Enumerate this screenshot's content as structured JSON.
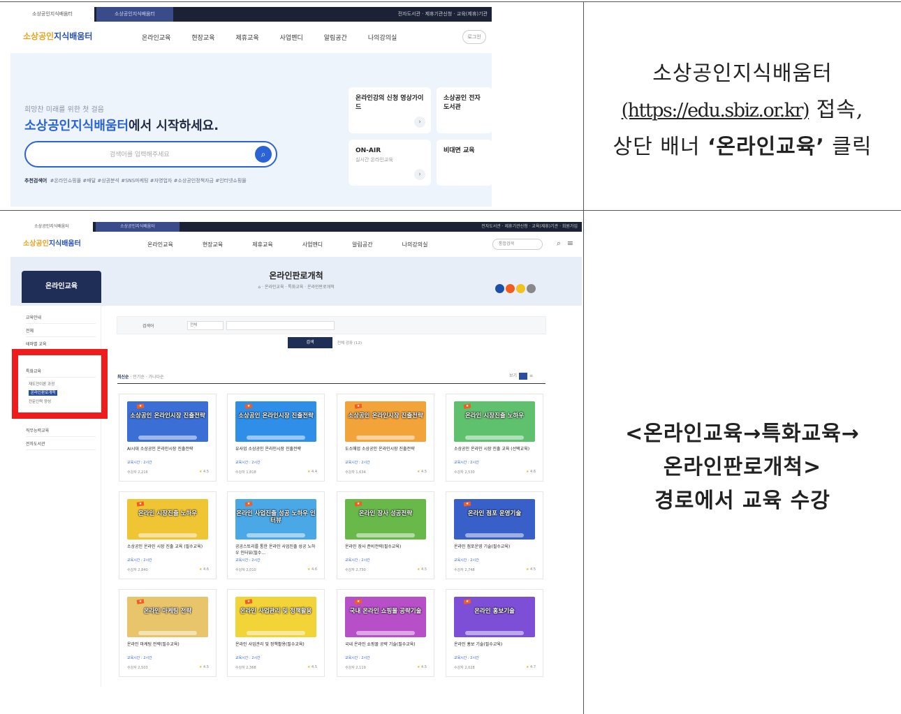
{
  "right_column": {
    "row1": {
      "line1": "소상공인지식배움터",
      "url": "(https://edu.sbiz.or.kr)",
      "line2_suffix": " 접속,",
      "line3_prefix": "상단 배너 ",
      "line3_bold": "‘온라인교육’",
      "line3_suffix": " 클릭"
    },
    "row2": {
      "line1": "<온라인교육→특화교육→",
      "line2": "온라인판로개척>",
      "line3": "경로에서 교육 수강"
    }
  },
  "screenshot1": {
    "top_tab_1": "소상공인지식배움터",
    "top_tab_2": "소상공인지식배움터",
    "top_right": "전자도서관 · 제휴기관신청 · 교육(제휴)기관",
    "logo_a": "소상공인",
    "logo_b": "지식배움터",
    "menu": [
      "온라인교육",
      "현장교육",
      "제휴교육",
      "사업멘디",
      "알림공간",
      "나의강의실"
    ],
    "login": "로그인",
    "hero_sub": "희망찬 미래를 위한 첫 걸음",
    "hero_title_highlight": "소상공인지식배움터",
    "hero_title_rest": "에서 시작하세요.",
    "search_placeholder": "검색어를 입력해주세요",
    "tags_label": "추천검색어",
    "tags": "#온라인쇼핑몰  #배달  #상권분석  #SNS마케팅  #자영업자  #소상공인정책자금  #인터넷쇼핑몰",
    "cards": [
      {
        "title": "온라인강의 신청 영상가이드",
        "sub": ""
      },
      {
        "title": "소상공인 전자도서관",
        "sub": ""
      },
      {
        "title": "ON-AIR",
        "sub": "실시간 온라인교육"
      },
      {
        "title": "비대면 교육",
        "sub": ""
      }
    ]
  },
  "screenshot2": {
    "top_tab_1": "소상공인지식배움터",
    "top_tab_2": "소상공인지식배움터",
    "top_right": "전자도서관 · 제휴기관신청 · 교육(제휴)기관 · 회원가입",
    "logo_a": "소상공인",
    "logo_b": "지식배움터",
    "menu": [
      "온라인교육",
      "현장교육",
      "제휴교육",
      "사업멘디",
      "알림공간",
      "나의강의실"
    ],
    "nav_search": "통합검색",
    "page_title": "온라인판로개척",
    "breadcrumb": "⌂ · 온라인교육 · 특화교육 · 온라인판로개척",
    "side_head": "온라인교육",
    "side_items": [
      "교육안내",
      "전체",
      "테마별 교육",
      "특화교육",
      "직무능력교육",
      "전자도서관"
    ],
    "side_subs": [
      "재도전이론 과정",
      "온라인판로개척",
      "전문인력 양성"
    ],
    "filter_label": "검색어",
    "filter_select": "전체",
    "search_button": "검색",
    "result_count": "전체 강좌 (12)",
    "tabs": [
      "최신순",
      "인기순",
      "가나다순"
    ],
    "view_label": "보기",
    "courses": [
      {
        "thumb": "소상공인 온라인시장 진출전략",
        "title": "AI시대 소상공인 온라인시장 진출전략",
        "meta": "교육시간 : 2시간",
        "count": "수강자 2,216",
        "rating": "4.5"
      },
      {
        "thumb": "소상공인 온라인시장 진출전략",
        "title": "유사업 소상공인 온라인시장 진출전략",
        "meta": "교육시간 : 2시간",
        "count": "수강자 1,818",
        "rating": "4.4"
      },
      {
        "thumb": "소상공인 온라인시장 진출전략",
        "title": "도소매업 소상공인 온라인시장 진출전략",
        "meta": "교육시간 : 2시간",
        "count": "수강자 1,634",
        "rating": "4.5"
      },
      {
        "thumb": "온라인 시장진출 노하우",
        "title": "소상공인 온라인 시장 진출 교육 (선택교육)",
        "meta": "교육시간 : 2시간",
        "count": "수강자 2,530",
        "rating": "4.6"
      },
      {
        "thumb": "온라인 시장진출 노하우",
        "title": "소상공인 온라인 시장 진출 교육 (필수교육)",
        "meta": "교육시간 : 2시간",
        "count": "수강자 2,840",
        "rating": "4.6"
      },
      {
        "thumb": "온라인 사업진출 성공 노하우 인터뷰",
        "title": "공공스토리를 통한 온라인 사업진출 성공 노하우 인터뷰(필수...",
        "meta": "교육시간 : 2시간",
        "count": "수강자 2,010",
        "rating": "4.6"
      },
      {
        "thumb": "온라인 장사 성공전략",
        "title": "온라인 장사 준비전략(필수교육)",
        "meta": "교육시간 : 2시간",
        "count": "수강자 2,730",
        "rating": "4.5"
      },
      {
        "thumb": "온라인 점포 운영기술",
        "title": "온라인 점포운영 기술(필수교육)",
        "meta": "교육시간 : 2시간",
        "count": "수강자 2,748",
        "rating": "4.5"
      },
      {
        "thumb": "온라인 마케팅 전략",
        "title": "온라인 마케팅 전략(필수교육)",
        "meta": "교육시간 : 2시간",
        "count": "수강자 2,503",
        "rating": "4.5"
      },
      {
        "thumb": "온라인 사업관리 및 정책활용",
        "title": "온라인 사업관리 및 정책활용(필수교육)",
        "meta": "교육시간 : 2시간",
        "count": "수강자 2,368",
        "rating": "4.5"
      },
      {
        "thumb": "국내 온라인 쇼핑몰 공략기술",
        "title": "국내 온라인 쇼핑몰 공략 기술(필수교육)",
        "meta": "교육시간 : 2시간",
        "count": "수강자 2,119",
        "rating": "4.5"
      },
      {
        "thumb": "온라인 홍보기술",
        "title": "온라인 홍보 기술(필수교육)",
        "meta": "교육시간 : 2시간",
        "count": "수강자 2,028",
        "rating": "4.7"
      }
    ]
  },
  "colors": {
    "highlight_box": "#ee1c1c",
    "brand_blue": "#2a63d6",
    "brand_navy": "#1f2e57",
    "logo_orange": "#e9a21b",
    "thumbs": [
      "#3b6fd6",
      "#2f8fe8",
      "#f2a43a",
      "#5fc06e",
      "#f0c534",
      "#4aa8e6",
      "#68b84a",
      "#3860c8",
      "#e8c46a",
      "#f2d338",
      "#b64fc8",
      "#7c4fd6"
    ]
  }
}
